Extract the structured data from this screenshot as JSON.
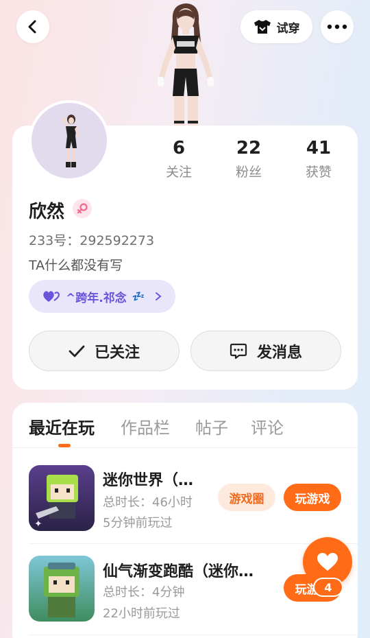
{
  "header": {
    "tryon_label": "试穿",
    "back_icon": "chevron-left-icon",
    "more_icon": "more-horizontal-icon"
  },
  "stats": [
    {
      "value": "6",
      "label": "关注"
    },
    {
      "value": "22",
      "label": "粉丝"
    },
    {
      "value": "41",
      "label": "获赞"
    }
  ],
  "profile": {
    "name": "欣然",
    "gender_icon": "female-icon",
    "uid": "233号：292592273",
    "bio": "TA什么都没有写",
    "tag_label": "^跨年.祁念",
    "tag_trailing": "💤"
  },
  "actions": {
    "followed_label": "已关注",
    "message_label": "发消息"
  },
  "tabs": [
    "最近在玩",
    "作品栏",
    "帖子",
    "评论"
  ],
  "games": [
    {
      "title": "迷你世界（…",
      "duration": "总时长：46小时",
      "last_played": "5分钟前玩过",
      "circle_label": "游戏圈",
      "play_label": "玩游戏"
    },
    {
      "title": "仙气渐变跑酷（迷你…",
      "duration": "总时长：4分钟",
      "last_played": "22小时前玩过",
      "play_label": "玩游戏"
    }
  ],
  "fab": {
    "icon": "heart-icon",
    "count": "4"
  },
  "colors": {
    "accent": "#ff6b16",
    "accent_light": "#feeadd",
    "tag_bg": "#e9e5fb",
    "tag_text": "#6a54d8"
  }
}
